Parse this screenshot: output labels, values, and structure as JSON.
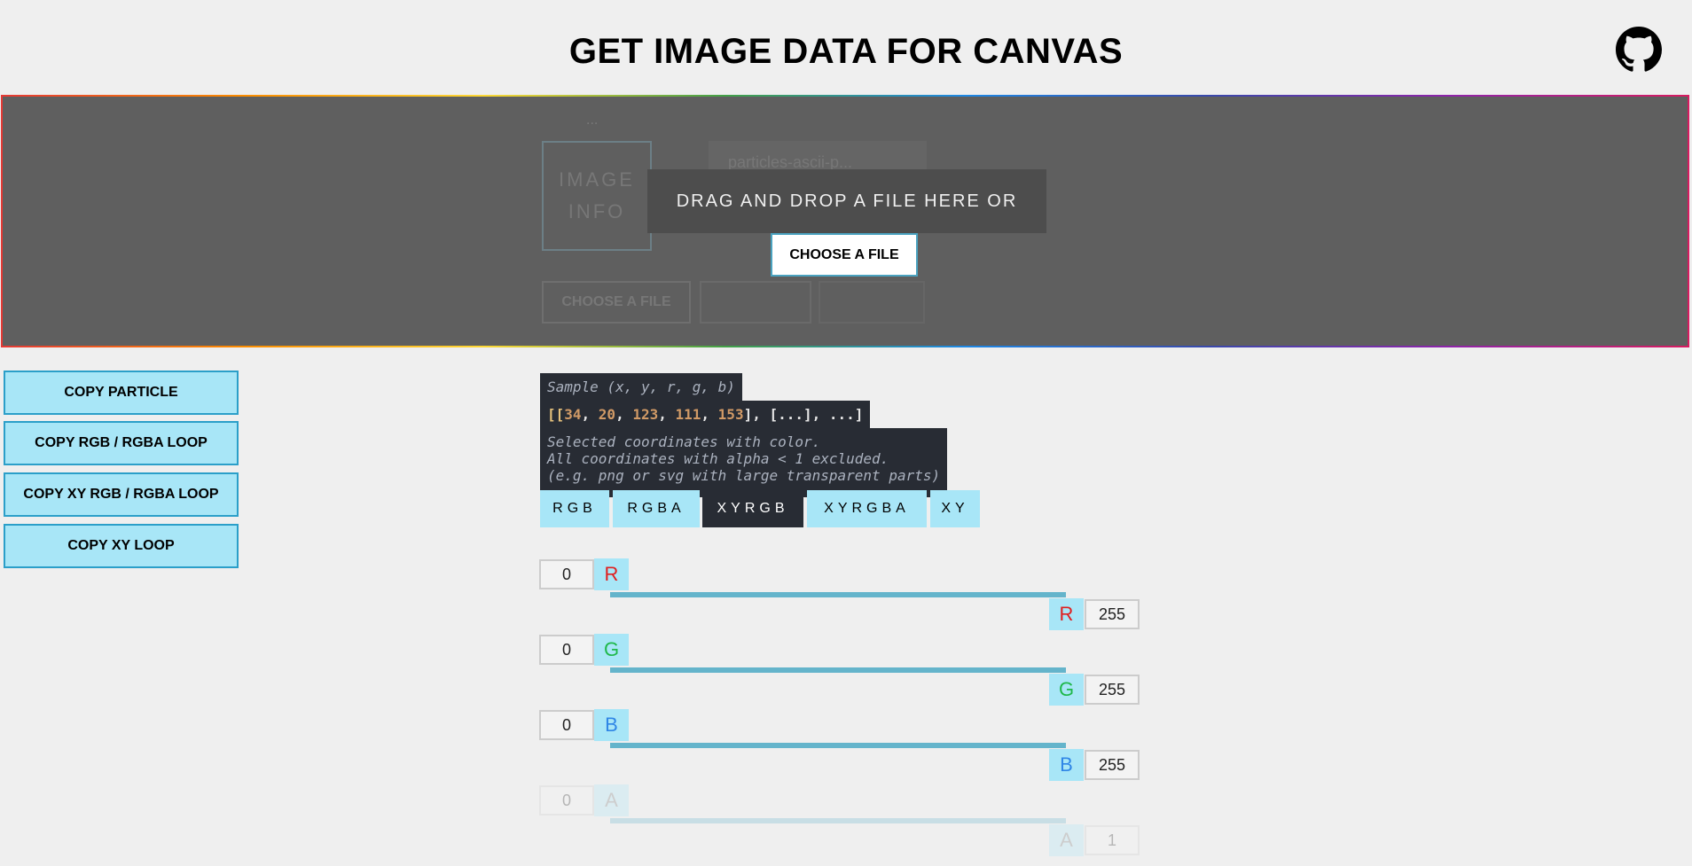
{
  "header": {
    "title": "GET IMAGE DATA FOR CANVAS",
    "github_icon": "github-icon"
  },
  "dropzone": {
    "prompt": "DRAG AND DROP A FILE HERE OR",
    "choose_label": "CHOOSE A FILE",
    "background_ghost": {
      "dots": "...",
      "image_info": "IMAGE INFO",
      "name_field": "particles-ascii-p...",
      "choose_label": "CHOOSE A FILE"
    }
  },
  "copy_buttons": [
    "COPY PARTICLE",
    "COPY RGB / RGBA LOOP",
    "COPY XY RGB / RGBA LOOP",
    "COPY XY LOOP"
  ],
  "sample": {
    "heading": "Sample (x, y, r, g, b)",
    "code": {
      "open": "[[",
      "n1": "34",
      "n2": "20",
      "n3": "123",
      "n4": "111",
      "n5": "153",
      "close": "], [...], ...]"
    },
    "note_lines": [
      "Selected coordinates with color.",
      "All coordinates with alpha < 1 excluded.",
      "(e.g. png or svg with large transparent parts)"
    ]
  },
  "tabs": [
    {
      "label": "RGB",
      "active": false
    },
    {
      "label": "RGBA",
      "active": false
    },
    {
      "label": "XYRGB",
      "active": true
    },
    {
      "label": "XYRGBA",
      "active": false
    },
    {
      "label": "XY",
      "active": false
    }
  ],
  "channels": [
    {
      "name": "R",
      "min": "0",
      "max": "255",
      "color": "#e02020"
    },
    {
      "name": "G",
      "min": "0",
      "max": "255",
      "color": "#1fb84a"
    },
    {
      "name": "B",
      "min": "0",
      "max": "255",
      "color": "#2f86e6"
    },
    {
      "name": "A",
      "min": "0",
      "max": "1",
      "color": "#777777",
      "disabled": true
    }
  ],
  "colors": {
    "accent": "#a8e6f7",
    "border": "#2b9fc9",
    "dark": "#282c34",
    "track": "#64b4cb"
  }
}
